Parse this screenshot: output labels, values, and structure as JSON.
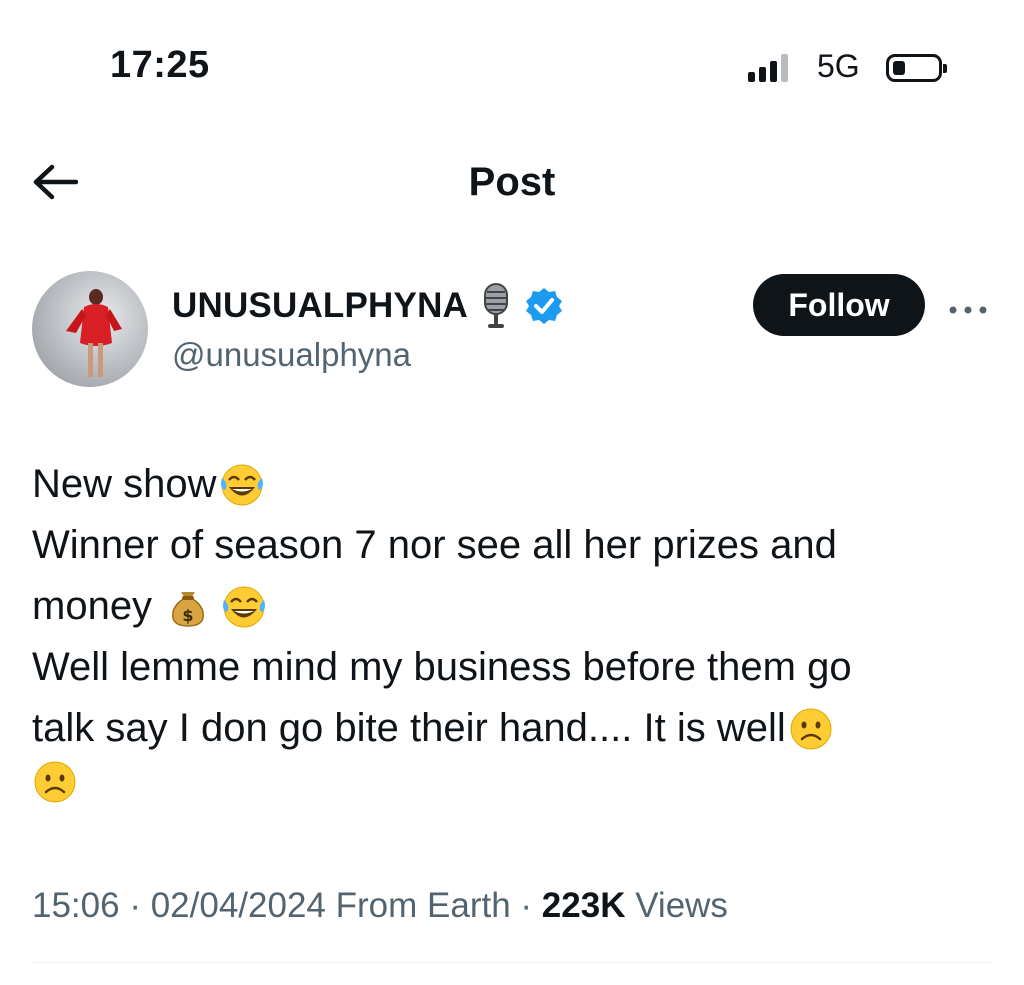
{
  "status_bar": {
    "time": "17:25",
    "network": "5G",
    "signal_bars_active": 3,
    "battery_level": 0.2
  },
  "header": {
    "title": "Post",
    "back_icon": "arrow-left-icon"
  },
  "author": {
    "display_name": "UNUSUALPHYNA",
    "name_emoji": "microphone-icon",
    "verified_icon": "verified-badge-icon",
    "handle": "@unusualphyna",
    "follow_label": "Follow",
    "more_icon": "more-horizontal-icon"
  },
  "tweet": {
    "lines": [
      {
        "text": "New show",
        "emojis": [
          "tears-of-joy"
        ]
      },
      {
        "text": "Winner of season 7 nor see all her prizes and",
        "emojis": []
      },
      {
        "text": "money ",
        "emojis": [
          "money-bag",
          "tears-of-joy"
        ]
      },
      {
        "text": "Well lemme mind my business before them go",
        "emojis": []
      },
      {
        "text": "talk say I don go bite their hand.... It is well",
        "emojis": [
          "frowning-face"
        ]
      },
      {
        "text": "",
        "emojis": [
          "frowning-face"
        ]
      }
    ]
  },
  "meta": {
    "time": "15:06",
    "separator": "·",
    "date": "02/04/2024",
    "location": "From Earth",
    "views_count": "223K",
    "views_label": "Views"
  },
  "colors": {
    "text_primary": "#0f1419",
    "text_secondary": "#536471",
    "verified_blue": "#1d9bf0",
    "follow_bg": "#0f1419"
  }
}
